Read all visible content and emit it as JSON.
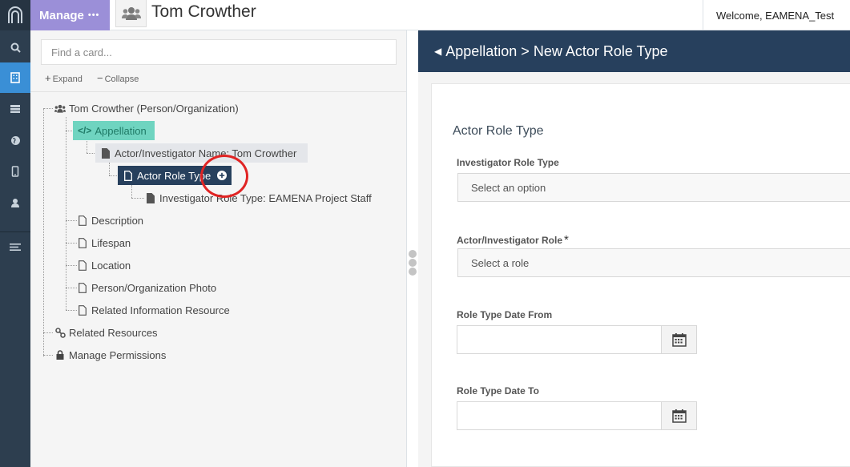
{
  "header": {
    "manage_label": "Manage",
    "manage_dots": "•••",
    "resource_title": "Tom Crowther",
    "welcome_text": "Welcome, EAMENA_Test"
  },
  "rail": {
    "icons": [
      "logo-icon",
      "search-icon",
      "building-icon",
      "database-icon",
      "globe-icon",
      "mobile-icon",
      "user-icon",
      "menu-icon"
    ],
    "active_index": 2,
    "active_color": "#3a8fd6"
  },
  "tree": {
    "search_placeholder": "Find a card...",
    "expand_label": "Expand",
    "collapse_label": "Collapse",
    "nodes": {
      "root": "Tom Crowther (Person/Organization)",
      "appellation": "Appellation",
      "actor_name": "Actor/Investigator Name: Tom Crowther",
      "actor_role_type": "Actor Role Type",
      "investigator_role_type": "Investigator Role Type: EAMENA Project Staff",
      "description": "Description",
      "lifespan": "Lifespan",
      "location": "Location",
      "photo": "Person/Organization Photo",
      "related_info": "Related Information Resource",
      "related_resources": "Related Resources",
      "manage_permissions": "Manage Permissions"
    }
  },
  "form": {
    "breadcrumb": "Appellation > New Actor Role Type",
    "card_title": "Actor Role Type",
    "fields": {
      "investigator_role_type": {
        "label": "Investigator Role Type",
        "placeholder": "Select an option"
      },
      "actor_role": {
        "label": "Actor/Investigator Role",
        "required_mark": "*",
        "placeholder": "Select a role"
      },
      "date_from": {
        "label": "Role Type Date From",
        "value": ""
      },
      "date_to": {
        "label": "Role Type Date To",
        "value": ""
      }
    }
  },
  "colors": {
    "header_dark": "#27405d",
    "manage_purple": "#9b8fd8",
    "appellation_green": "#6fd4c0",
    "annotation_red": "#e02424"
  }
}
